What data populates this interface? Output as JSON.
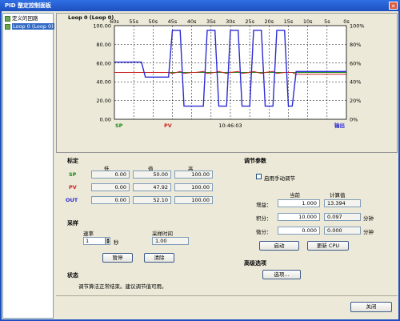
{
  "window": {
    "title": "PID 整定控制面板"
  },
  "tree": {
    "root": "定义的回路",
    "selected": "Loop 0 (Loop 0)"
  },
  "chart_data": {
    "type": "line",
    "title": "Loop 0 (Loop 0)",
    "x_ticks": [
      "60s",
      "55s",
      "50s",
      "45s",
      "40s",
      "35s",
      "30s",
      "25s",
      "20s",
      "15s",
      "10s",
      "5s",
      "0s"
    ],
    "y_left_ticks": [
      "100.00",
      "80.00",
      "60.00",
      "40.00",
      "20.00",
      "0.00"
    ],
    "y_right_ticks": [
      "100%",
      "80%",
      "60%",
      "40%",
      "20%",
      "0%"
    ],
    "ylim": [
      0,
      100
    ],
    "x": [
      60,
      57,
      55,
      53,
      52,
      49,
      48,
      46,
      45,
      43,
      42,
      40,
      39,
      37,
      36,
      34,
      33,
      31,
      30,
      28,
      27,
      25,
      24,
      22,
      21,
      19,
      18,
      16,
      15,
      14,
      13,
      10,
      5,
      0
    ],
    "series": [
      {
        "name": "输出",
        "color": "#2b2bd4",
        "values": [
          61,
          61,
          61,
          61,
          45,
          45,
          45,
          45,
          95,
          95,
          14,
          14,
          14,
          14,
          95,
          95,
          14,
          14,
          95,
          95,
          14,
          14,
          95,
          95,
          14,
          14,
          95,
          95,
          14,
          14,
          51,
          51,
          51,
          51
        ]
      },
      {
        "name": "PV",
        "color": "#cc2222",
        "values": [
          50,
          50,
          50,
          50,
          50,
          50,
          50,
          50,
          49,
          51,
          49,
          50,
          50,
          51,
          49,
          50,
          51,
          49,
          50,
          51,
          49,
          50,
          51,
          49,
          50,
          51,
          49,
          50,
          50,
          50,
          48,
          48,
          48,
          48
        ]
      },
      {
        "name": "SP",
        "color": "#1a8a1a",
        "values": [
          50,
          50,
          50,
          50,
          50,
          50,
          50,
          50,
          50,
          50,
          50,
          50,
          50,
          50,
          50,
          50,
          50,
          50,
          50,
          50,
          50,
          50,
          50,
          50,
          50,
          50,
          50,
          50,
          50,
          50,
          50,
          50,
          50,
          50
        ]
      }
    ],
    "legend": {
      "sp": "SP",
      "pv": "PV",
      "out": "输出"
    },
    "timestamp": "10:46:03",
    "grid": true
  },
  "tuning": {
    "title": "标定",
    "headers": [
      "低",
      "值",
      "高"
    ],
    "rows": [
      {
        "label": "SP",
        "low": "0.00",
        "value": "50.00",
        "high": "100.00"
      },
      {
        "label": "PV",
        "low": "0.00",
        "value": "47.92",
        "high": "100.00"
      },
      {
        "label": "OUT",
        "low": "0.00",
        "value": "52.10",
        "high": "100.00"
      }
    ]
  },
  "sampling": {
    "title": "采样",
    "rate_label": "速率",
    "rate_value": "1",
    "rate_unit": "秒",
    "time_label": "采样时间",
    "time_value": "1.00",
    "pause_button": "暂停",
    "clear_button": "清除"
  },
  "status": {
    "title": "状态",
    "message": "调节算法正常结束。建议调节值可用。"
  },
  "params": {
    "title": "调节参数",
    "manual_label": "启用手动调节",
    "col_current": "当前",
    "col_calc": "计算值",
    "rows": [
      {
        "label": "增益：",
        "current": "1.000",
        "calc": "13.394",
        "unit": ""
      },
      {
        "label": "积分：",
        "current": "10.000",
        "calc": "0.097",
        "unit": "分钟"
      },
      {
        "label": "微分：",
        "current": "0.000",
        "calc": "0.000",
        "unit": "分钟"
      }
    ],
    "start_button": "启动",
    "update_button": "更新 CPU"
  },
  "advanced": {
    "title": "高级选项",
    "options_button": "选项..."
  },
  "footer": {
    "close_button": "关闭"
  }
}
